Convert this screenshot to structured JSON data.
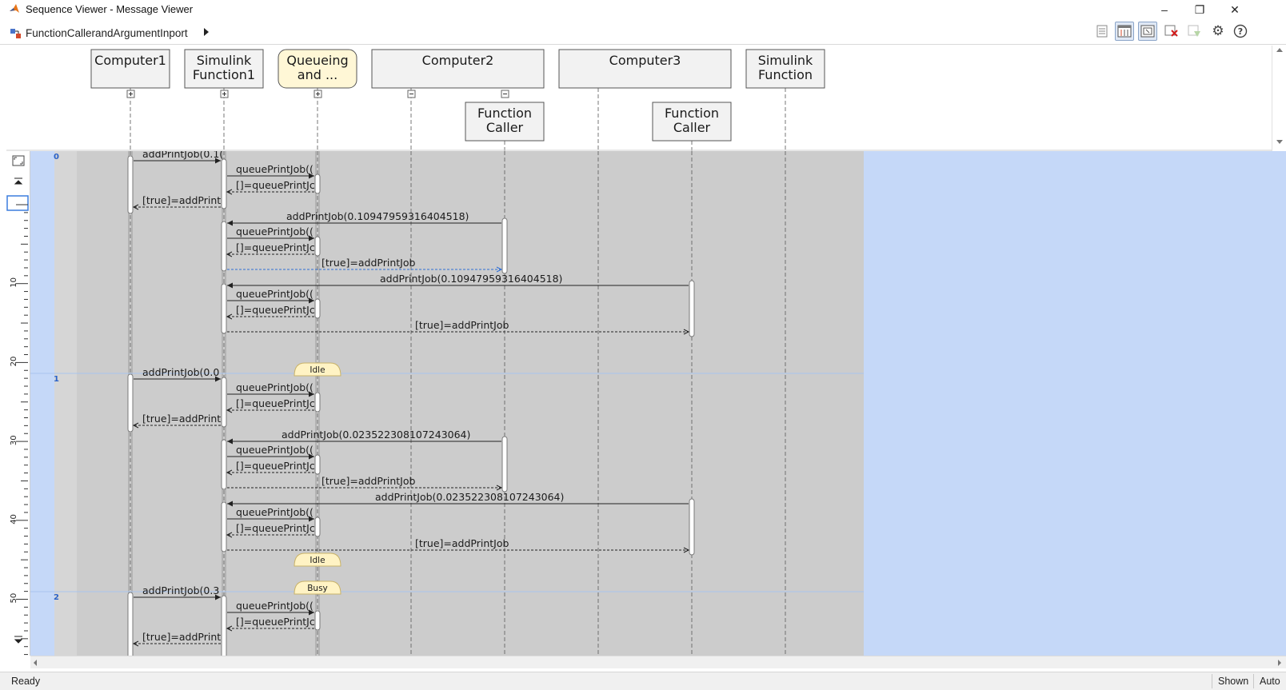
{
  "window": {
    "title": "Sequence Viewer - Message Viewer",
    "minimize_glyph": "–",
    "restore_glyph": "❐",
    "close_glyph": "✕"
  },
  "breadcrumb": {
    "model_name": "FunctionCallerandArgumentInport"
  },
  "toolbar": {
    "icons": [
      "properties-icon",
      "time-ruler-icon",
      "show-inports-icon",
      "delete-icon",
      "filter-icon",
      "settings-icon",
      "help-icon"
    ],
    "help_glyph": "?",
    "settings_glyph": "⚙"
  },
  "lifelines": [
    {
      "label_lines": [
        "Computer1"
      ]
    },
    {
      "label_lines": [
        "Simulink",
        "Function1"
      ]
    },
    {
      "label_lines": [
        "Queueing",
        "and ..."
      ]
    },
    {
      "label_lines": [
        "Computer2"
      ]
    },
    {
      "label_lines": [
        "Computer3"
      ]
    },
    {
      "label_lines": [
        "Simulink",
        "Function"
      ]
    },
    {
      "label_lines": [
        "Function",
        "Caller"
      ]
    },
    {
      "label_lines": [
        "Function",
        "Caller"
      ]
    }
  ],
  "ruler": {
    "labels": [
      "10",
      "20",
      "30",
      "40",
      "50"
    ]
  },
  "time_markers": [
    "0",
    "1",
    "2"
  ],
  "states": [
    "Idle",
    "Idle",
    "Busy"
  ],
  "messages": [
    "addPrintJob(0.1(",
    "queuePrintJob((",
    "[]=queuePrintJc",
    "[true]=addPrint",
    "addPrintJob(0.10947959316404518)",
    "queuePrintJob((",
    "[]=queuePrintJc",
    "[true]=addPrintJob",
    "addPrintJob(0.10947959316404518)",
    "queuePrintJob((",
    "[]=queuePrintJc",
    "[true]=addPrintJob",
    "addPrintJob(0.0",
    "queuePrintJob((",
    "[]=queuePrintJc",
    "[true]=addPrint",
    "addPrintJob(0.023522308107243064)",
    "queuePrintJob((",
    "[]=queuePrintJc",
    "[true]=addPrintJob",
    "addPrintJob(0.023522308107243064)",
    "queuePrintJob((",
    "[]=queuePrintJc",
    "[true]=addPrintJob",
    "addPrintJob(0.3",
    "queuePrintJob((",
    "[]=queuePrintJc",
    "[true]=addPrint"
  ],
  "status": {
    "ready": "Ready",
    "shown": "Shown",
    "auto": "Auto"
  },
  "colors": {
    "canvas_bg": "#c5d8f8",
    "band_bg": "#cccccc",
    "state_fill": "#fff3c4",
    "selected_line": "#3b7ddd",
    "matlab_orange": "#e8761a"
  }
}
